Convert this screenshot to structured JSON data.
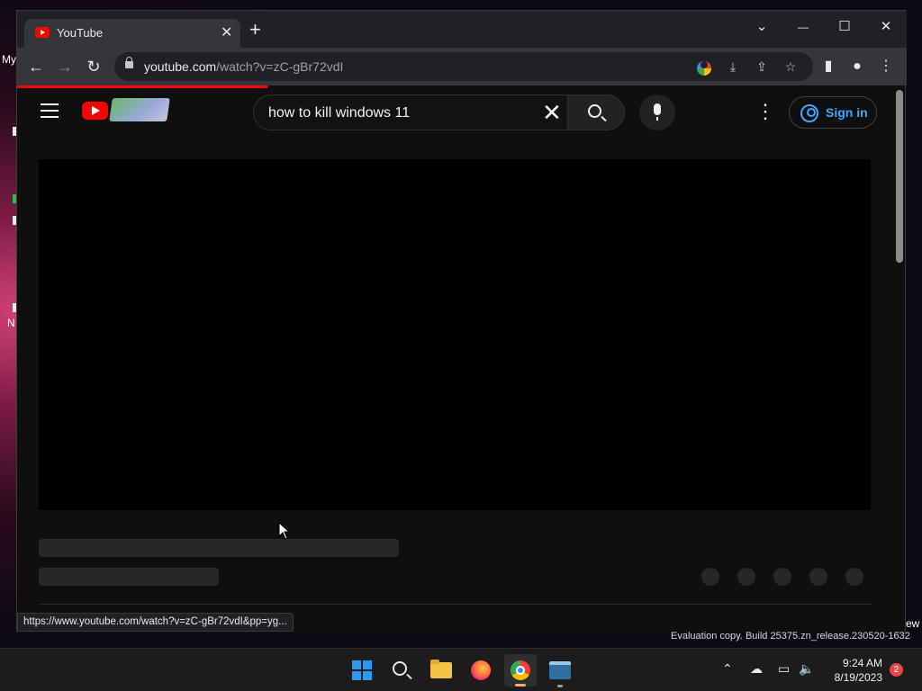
{
  "desktop": {
    "icon_label_fragment": "My",
    "icon_label_fragment2": "N",
    "right_edge_text": "ew"
  },
  "browser": {
    "tab": {
      "title": "YouTube",
      "close": "✕"
    },
    "new_tab": "+",
    "window_controls": {
      "tab_search": "⌄",
      "minimize": "—",
      "maximize": "☐",
      "close": "✕"
    },
    "nav": {
      "back": "←",
      "forward": "→",
      "reload": "↻"
    },
    "url_host": "youtube.com",
    "url_path": "/watch?v=zC-gBr72vdI",
    "status_url": "https://www.youtube.com/watch?v=zC-gBr72vdI&pp=yg..."
  },
  "youtube": {
    "search_query": "how to kill windows 11",
    "clear_symbol": "✕",
    "more_symbol": "⋮",
    "sign_in_label": "Sign in",
    "accent_color": "#3ea6ff",
    "brand_color": "#ff0000"
  },
  "os": {
    "watermark": "Evaluation copy. Build 25375.zn_release.230520-1632",
    "clock_time": "9:24 AM",
    "clock_date": "8/19/2023",
    "notification_count": "2"
  }
}
